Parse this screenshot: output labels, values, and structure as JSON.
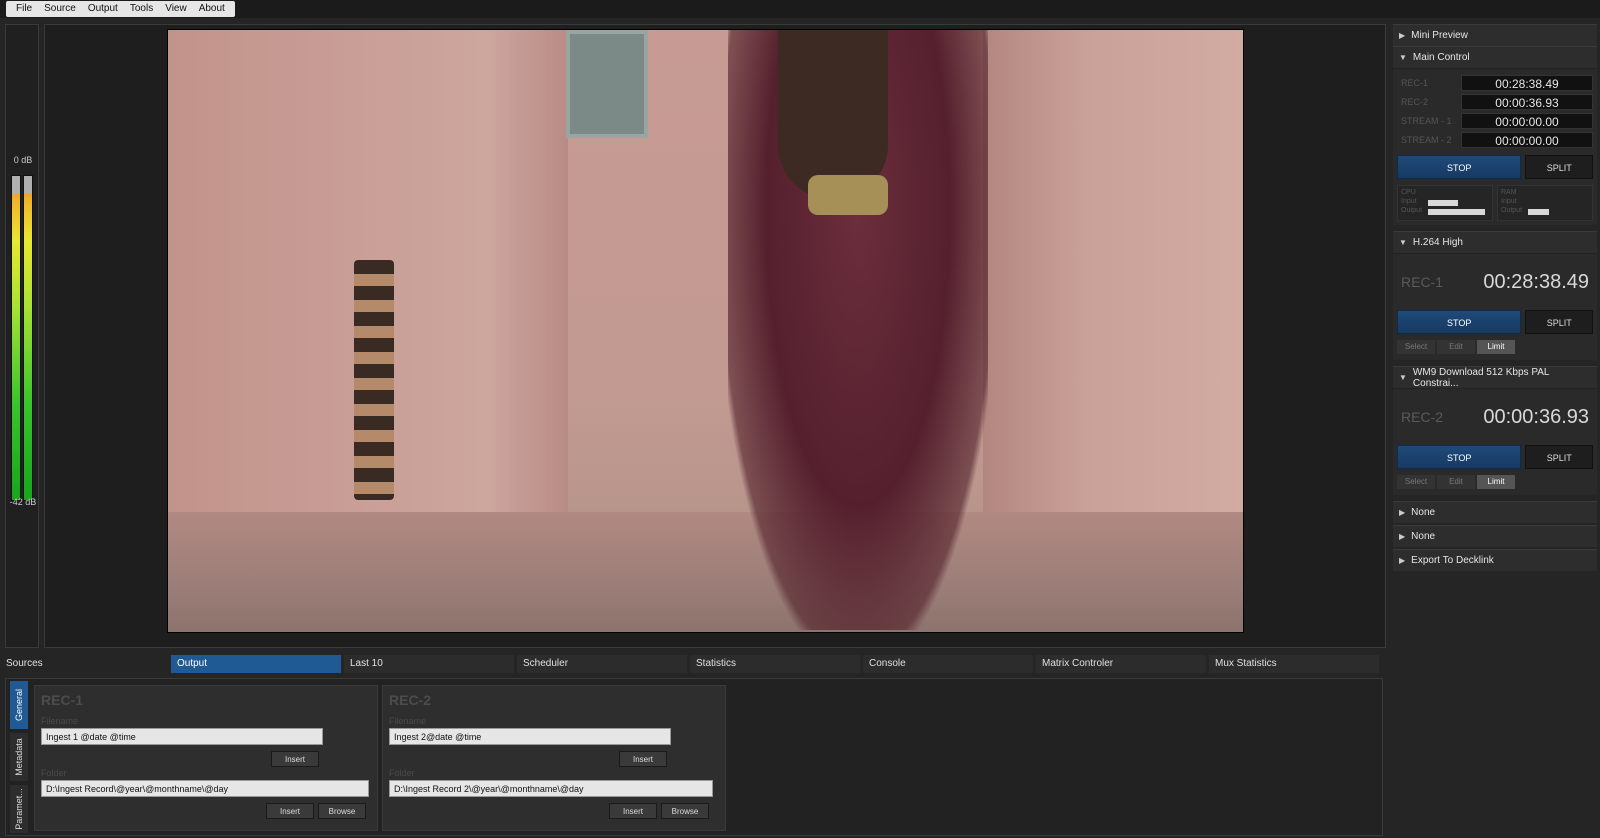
{
  "menu": [
    "File",
    "Source",
    "Output",
    "Tools",
    "View",
    "About"
  ],
  "audio_meter": {
    "top_label": "0 dB",
    "bottom_label": "-42 dB"
  },
  "right_panel": {
    "mini_preview": "Mini Preview",
    "main_control": {
      "title": "Main Control",
      "rows": [
        {
          "label": "REC-1",
          "time": "00:28:38.49"
        },
        {
          "label": "REC-2",
          "time": "00:00:36.93"
        },
        {
          "label": "STREAM - 1",
          "time": "00:00:00.00"
        },
        {
          "label": "STREAM - 2",
          "time": "00:00:00.00"
        }
      ],
      "stop": "STOP",
      "split": "SPLIT",
      "cpu": {
        "label": "CPU",
        "sub1": "Input",
        "sub2": "Output",
        "input_level": 0.5,
        "output_level": 0.95
      },
      "ram": {
        "label": "RAM",
        "sub1": "Input",
        "sub2": "Output",
        "input_level": 0.0,
        "output_level": 0.35
      }
    },
    "encoders": [
      {
        "title": "H.264 High",
        "label": "REC-1",
        "time": "00:28:38.49",
        "stop": "STOP",
        "split": "SPLIT",
        "select": "Select",
        "edit": "Edit",
        "limit": "Limit"
      },
      {
        "title": "WM9 Download 512 Kbps PAL Constrai...",
        "label": "REC-2",
        "time": "00:00:36.93",
        "stop": "STOP",
        "split": "SPLIT",
        "select": "Select",
        "edit": "Edit",
        "limit": "Limit"
      }
    ],
    "collapsed": [
      "None",
      "None",
      "Export To Decklink"
    ]
  },
  "tabs": {
    "sources": "Sources",
    "items": [
      "Output",
      "Last 10",
      "Scheduler",
      "Statistics",
      "Console",
      "Matrix Controler",
      "Mux Statistics"
    ],
    "active": "Output"
  },
  "side_tabs": [
    "General",
    "Metadata",
    "Paramet..."
  ],
  "recorders": [
    {
      "title": "REC-1",
      "filename_label": "Filename",
      "filename": "Ingest 1 @date @time",
      "insert": "Insert",
      "folder_label": "Folder",
      "folder": "D:\\Ingest Record\\@year\\@monthname\\@day",
      "insert2": "Insert",
      "browse": "Browse"
    },
    {
      "title": "REC-2",
      "filename_label": "Filename",
      "filename": "Ingest 2@date @time",
      "insert": "Insert",
      "folder_label": "Folder",
      "folder": "D:\\Ingest Record 2\\@year\\@monthname\\@day",
      "insert2": "Insert",
      "browse": "Browse"
    }
  ]
}
